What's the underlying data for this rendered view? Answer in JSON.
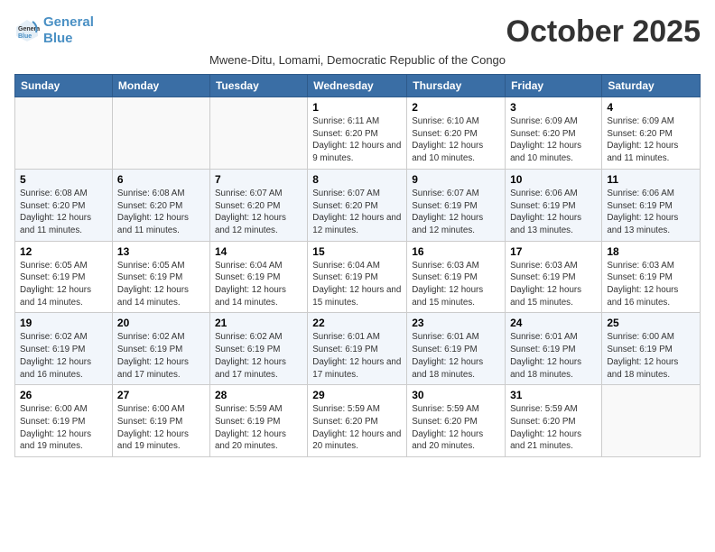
{
  "header": {
    "logo_line1": "General",
    "logo_line2": "Blue",
    "month": "October 2025",
    "subtitle": "Mwene-Ditu, Lomami, Democratic Republic of the Congo"
  },
  "weekdays": [
    "Sunday",
    "Monday",
    "Tuesday",
    "Wednesday",
    "Thursday",
    "Friday",
    "Saturday"
  ],
  "weeks": [
    [
      {
        "day": "",
        "info": ""
      },
      {
        "day": "",
        "info": ""
      },
      {
        "day": "",
        "info": ""
      },
      {
        "day": "1",
        "info": "Sunrise: 6:11 AM\nSunset: 6:20 PM\nDaylight: 12 hours and 9 minutes."
      },
      {
        "day": "2",
        "info": "Sunrise: 6:10 AM\nSunset: 6:20 PM\nDaylight: 12 hours and 10 minutes."
      },
      {
        "day": "3",
        "info": "Sunrise: 6:09 AM\nSunset: 6:20 PM\nDaylight: 12 hours and 10 minutes."
      },
      {
        "day": "4",
        "info": "Sunrise: 6:09 AM\nSunset: 6:20 PM\nDaylight: 12 hours and 11 minutes."
      }
    ],
    [
      {
        "day": "5",
        "info": "Sunrise: 6:08 AM\nSunset: 6:20 PM\nDaylight: 12 hours and 11 minutes."
      },
      {
        "day": "6",
        "info": "Sunrise: 6:08 AM\nSunset: 6:20 PM\nDaylight: 12 hours and 11 minutes."
      },
      {
        "day": "7",
        "info": "Sunrise: 6:07 AM\nSunset: 6:20 PM\nDaylight: 12 hours and 12 minutes."
      },
      {
        "day": "8",
        "info": "Sunrise: 6:07 AM\nSunset: 6:20 PM\nDaylight: 12 hours and 12 minutes."
      },
      {
        "day": "9",
        "info": "Sunrise: 6:07 AM\nSunset: 6:19 PM\nDaylight: 12 hours and 12 minutes."
      },
      {
        "day": "10",
        "info": "Sunrise: 6:06 AM\nSunset: 6:19 PM\nDaylight: 12 hours and 13 minutes."
      },
      {
        "day": "11",
        "info": "Sunrise: 6:06 AM\nSunset: 6:19 PM\nDaylight: 12 hours and 13 minutes."
      }
    ],
    [
      {
        "day": "12",
        "info": "Sunrise: 6:05 AM\nSunset: 6:19 PM\nDaylight: 12 hours and 14 minutes."
      },
      {
        "day": "13",
        "info": "Sunrise: 6:05 AM\nSunset: 6:19 PM\nDaylight: 12 hours and 14 minutes."
      },
      {
        "day": "14",
        "info": "Sunrise: 6:04 AM\nSunset: 6:19 PM\nDaylight: 12 hours and 14 minutes."
      },
      {
        "day": "15",
        "info": "Sunrise: 6:04 AM\nSunset: 6:19 PM\nDaylight: 12 hours and 15 minutes."
      },
      {
        "day": "16",
        "info": "Sunrise: 6:03 AM\nSunset: 6:19 PM\nDaylight: 12 hours and 15 minutes."
      },
      {
        "day": "17",
        "info": "Sunrise: 6:03 AM\nSunset: 6:19 PM\nDaylight: 12 hours and 15 minutes."
      },
      {
        "day": "18",
        "info": "Sunrise: 6:03 AM\nSunset: 6:19 PM\nDaylight: 12 hours and 16 minutes."
      }
    ],
    [
      {
        "day": "19",
        "info": "Sunrise: 6:02 AM\nSunset: 6:19 PM\nDaylight: 12 hours and 16 minutes."
      },
      {
        "day": "20",
        "info": "Sunrise: 6:02 AM\nSunset: 6:19 PM\nDaylight: 12 hours and 17 minutes."
      },
      {
        "day": "21",
        "info": "Sunrise: 6:02 AM\nSunset: 6:19 PM\nDaylight: 12 hours and 17 minutes."
      },
      {
        "day": "22",
        "info": "Sunrise: 6:01 AM\nSunset: 6:19 PM\nDaylight: 12 hours and 17 minutes."
      },
      {
        "day": "23",
        "info": "Sunrise: 6:01 AM\nSunset: 6:19 PM\nDaylight: 12 hours and 18 minutes."
      },
      {
        "day": "24",
        "info": "Sunrise: 6:01 AM\nSunset: 6:19 PM\nDaylight: 12 hours and 18 minutes."
      },
      {
        "day": "25",
        "info": "Sunrise: 6:00 AM\nSunset: 6:19 PM\nDaylight: 12 hours and 18 minutes."
      }
    ],
    [
      {
        "day": "26",
        "info": "Sunrise: 6:00 AM\nSunset: 6:19 PM\nDaylight: 12 hours and 19 minutes."
      },
      {
        "day": "27",
        "info": "Sunrise: 6:00 AM\nSunset: 6:19 PM\nDaylight: 12 hours and 19 minutes."
      },
      {
        "day": "28",
        "info": "Sunrise: 5:59 AM\nSunset: 6:19 PM\nDaylight: 12 hours and 20 minutes."
      },
      {
        "day": "29",
        "info": "Sunrise: 5:59 AM\nSunset: 6:20 PM\nDaylight: 12 hours and 20 minutes."
      },
      {
        "day": "30",
        "info": "Sunrise: 5:59 AM\nSunset: 6:20 PM\nDaylight: 12 hours and 20 minutes."
      },
      {
        "day": "31",
        "info": "Sunrise: 5:59 AM\nSunset: 6:20 PM\nDaylight: 12 hours and 21 minutes."
      },
      {
        "day": "",
        "info": ""
      }
    ]
  ]
}
